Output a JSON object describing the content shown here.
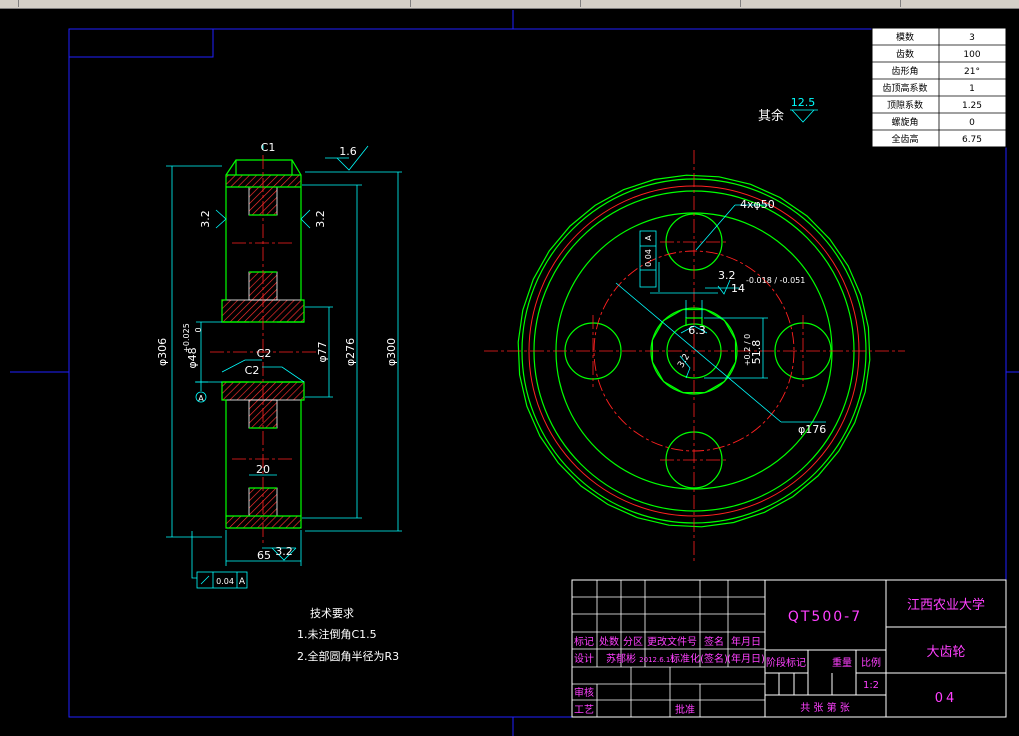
{
  "window": {
    "tabs": [
      "",
      "",
      "",
      ""
    ]
  },
  "params_table": {
    "rows": [
      {
        "label": "模数",
        "value": "3"
      },
      {
        "label": "齿数",
        "value": "100"
      },
      {
        "label": "齿形角",
        "value": "21°"
      },
      {
        "label": "齿顶高系数",
        "value": "1"
      },
      {
        "label": "顶隙系数",
        "value": "1.25"
      },
      {
        "label": "螺旋角",
        "value": "0"
      },
      {
        "label": "全齿高",
        "value": "6.75"
      }
    ]
  },
  "roughness_rest": {
    "prefix": "其余",
    "value": "12.5"
  },
  "side_view": {
    "chamfer_top": "C1",
    "roughness_top": "1.6",
    "roughness_left": "3.2",
    "roughness_right": "3.2",
    "dia_outer_left": "φ306",
    "dia_bore": "φ48",
    "bore_tol_upper": "+0.025",
    "bore_tol_lower": "0",
    "chamfer_c2_a": "C2",
    "chamfer_c2_b": "C2",
    "dia_hub": "φ77",
    "dia_web": "φ276",
    "dia_outer_right": "φ300",
    "web_width": "20",
    "face_width": "65",
    "roughness_bottom": "3.2",
    "datum_symbol": "A",
    "runout_tol": "0.04",
    "runout_datum": "A"
  },
  "front_view": {
    "holes": "4xφ50",
    "hole_circle": "φ176",
    "keyway_roughness": "3.2",
    "keyway_width": "14",
    "keyway_tol": "-0.018 / -0.051",
    "keyway_depth": "51.8",
    "keyway_depth_tol": "+0.2 / 0",
    "bore_roughness": "6.3",
    "bore_roughness_b": "3.2",
    "sym_tol": "0.04",
    "sym_datum": "A"
  },
  "tech_notes": {
    "title": "技术要求",
    "items": [
      "1.未注倒角C1.5",
      "2.全部圆角半径为R3"
    ]
  },
  "title_block": {
    "material": "QT500-7",
    "school": "江西农业大学",
    "part_name": "大齿轮",
    "drawing_no": "04",
    "row_labels": [
      "标记",
      "处数",
      "分区",
      "更改文件号",
      "签名",
      "年月日"
    ],
    "design_row": [
      "设计",
      "苏郁彬",
      "2012.6.11",
      "标准化",
      "(签名)",
      "(年月日)"
    ],
    "stage_label": "阶段标记",
    "weight_label": "重量",
    "scale_label": "比例",
    "scale_value": "1:2",
    "review": "审核",
    "process": "工艺",
    "approve": "批准",
    "sheets": "共  张  第  张"
  }
}
